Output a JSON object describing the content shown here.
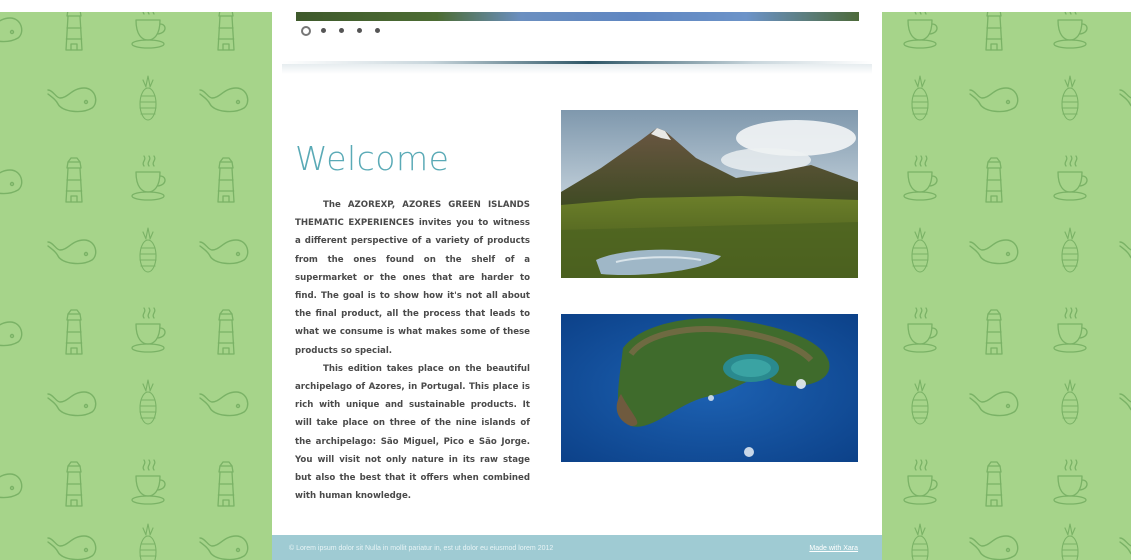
{
  "page": {
    "title": "Welcome",
    "paragraphs": [
      "The AZOREXP, AZORES GREEN ISLANDS THEMATIC EXPERIENCES invites you to witness a different perspective of a variety of products from the ones found on the shelf of a supermarket or the ones that are harder to find. The goal is to show how it's not all about the final product, all the process that leads to what we consume is what makes some of these products so special.",
      "This edition takes place on the beautiful archipelago of Azores, in Portugal. This place is rich with unique and sustainable products. It will take place on three of the nine islands of the archipelago: São Miguel, Pico e São Jorge. You will visit not only nature in its raw stage but also the best that it offers when combined with human knowledge."
    ]
  },
  "slider": {
    "dot_count": 5,
    "active_index": 0
  },
  "images": [
    {
      "icon": "mountain-landscape-photo"
    },
    {
      "icon": "island-aerial-photo"
    }
  ],
  "background": {
    "pattern_icons": [
      "lighthouse-icon",
      "coffee-cup-icon",
      "whale-icon",
      "pineapple-icon"
    ],
    "color": "#a6d48a",
    "stroke_color": "#7ab266"
  },
  "footer": {
    "copyright": "© Lorem ipsum dolor sit Nulla in mollit pariatur in, est ut dolor eu eiusmod lorem 2012",
    "link": "Made with Xara"
  },
  "colors": {
    "title": "#5aaab6",
    "footer_bg": "#9fcbd3",
    "text": "#4a4a4a"
  }
}
